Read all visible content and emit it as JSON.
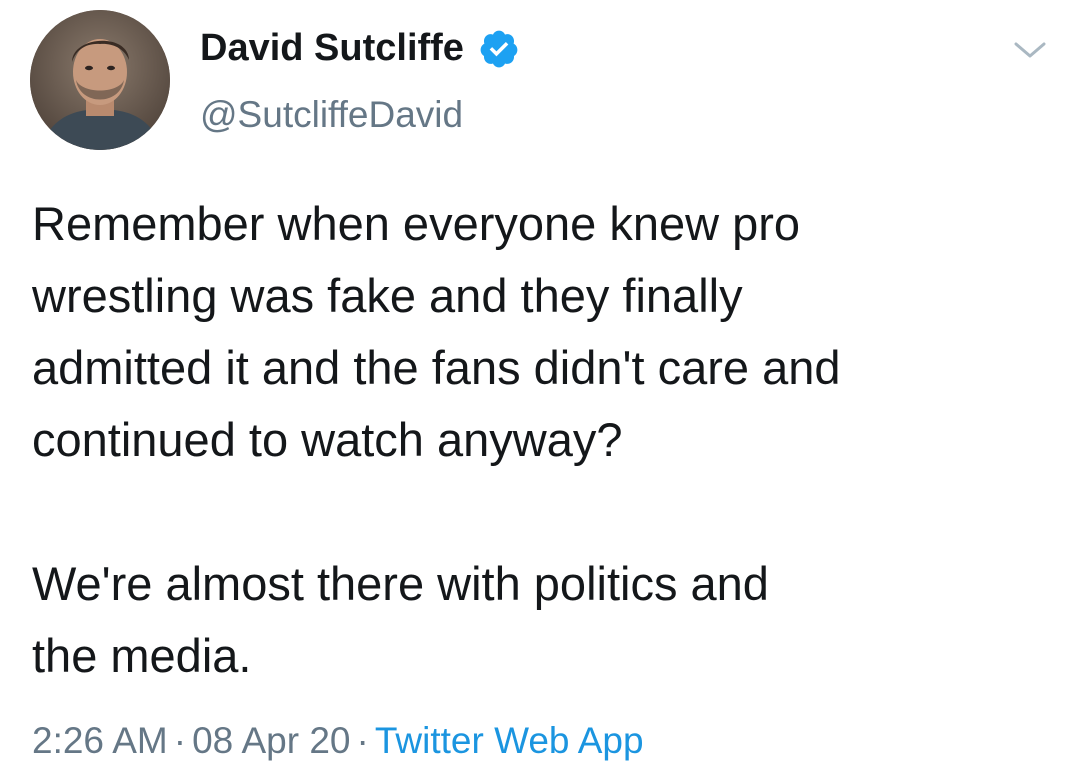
{
  "tweet": {
    "author": {
      "display_name": "David Sutcliffe",
      "handle": "@SutcliffeDavid",
      "verified": true,
      "avatar_icon": "profile-photo",
      "verified_icon": "verified-badge-icon"
    },
    "menu_icon": "chevron-down-icon",
    "paragraphs": [
      "Remember when everyone knew pro\nwrestling was fake and they finally\nadmitted it and the fans didn't care and\ncontinued to watch anyway?",
      "We're almost there with politics and\nthe media."
    ],
    "time": "2:26 AM",
    "date": "08 Apr 20",
    "separator": "·",
    "source": "Twitter Web App"
  },
  "colors": {
    "text_primary": "#14171a",
    "text_secondary": "#657786",
    "accent_blue": "#1da1f2",
    "link_blue": "#1b95e0",
    "background": "#ffffff"
  }
}
